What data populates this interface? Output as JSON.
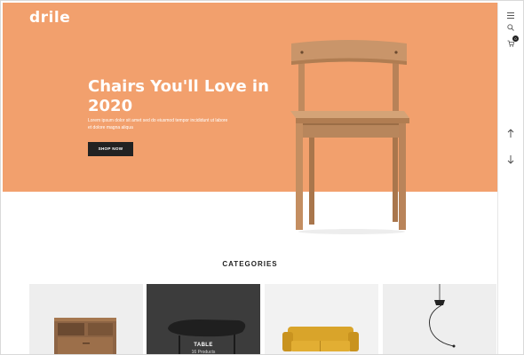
{
  "brand": {
    "logo_text": "drile"
  },
  "hero": {
    "title": "Chairs You'll Love in 2020",
    "description": "Lorem ipsum dolor sit amet sed do eiusmod tempor incididunt ut labore et dolore magna aliqua",
    "cta_label": "SHOP NOW",
    "background_color": "#f2a06d",
    "image": "wooden-chair"
  },
  "rail": {
    "icons": [
      "menu-icon",
      "search-icon",
      "cart-icon",
      "arrow-up-icon",
      "arrow-down-icon"
    ],
    "cart_count": "0"
  },
  "categories": {
    "heading": "CATEGORIES",
    "tiles": [
      {
        "image": "wooden-cabinet",
        "background_color": "#eeeeee"
      },
      {
        "image": "black-table",
        "background_color": "#3c3c3c",
        "name": "TABLE",
        "count": "16 Products"
      },
      {
        "image": "yellow-sofa",
        "background_color": "#f2f2f2"
      },
      {
        "image": "pendant-lamp",
        "background_color": "#eeeeee"
      }
    ]
  }
}
